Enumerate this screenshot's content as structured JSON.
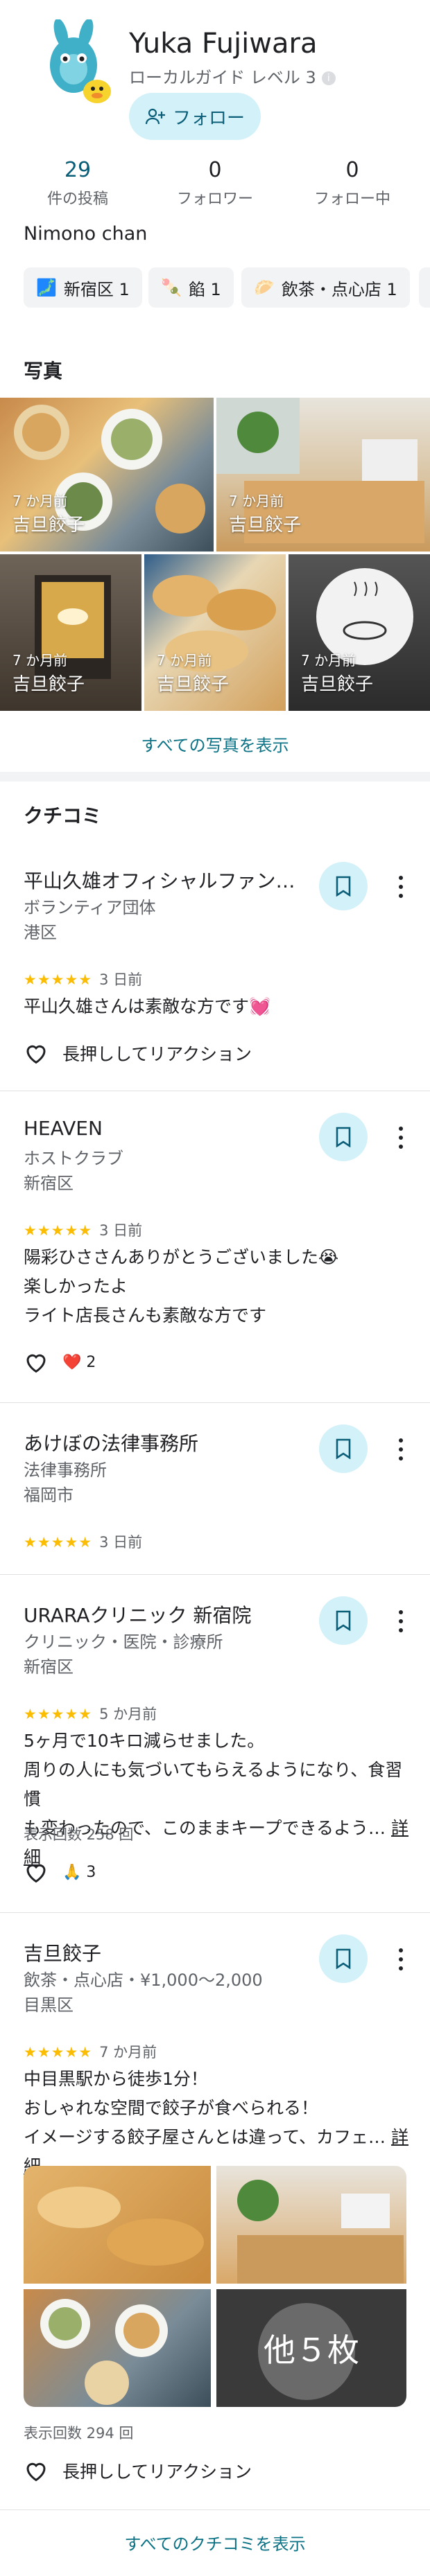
{
  "profile": {
    "name": "Yuka Fujiwara",
    "subtitle": "ローカルガイド レベル 3",
    "info": "i",
    "follow_label": "フォロー",
    "bio": "Nimono chan"
  },
  "stats": [
    {
      "num": "29",
      "label": "件の投稿"
    },
    {
      "num": "0",
      "label": "フォロワー"
    },
    {
      "num": "0",
      "label": "フォロー中"
    }
  ],
  "chips": [
    {
      "icon": "🗾",
      "label": "新宿区 1"
    },
    {
      "icon": "🍡",
      "label": "餡 1"
    },
    {
      "icon": "🥟",
      "label": "飲茶・点心店 1"
    }
  ],
  "photos": {
    "title": "写真",
    "items": [
      {
        "date": "7 か月前",
        "name": "吉旦餃子"
      },
      {
        "date": "7 か月前",
        "name": "吉旦餃子"
      },
      {
        "date": "7 か月前",
        "name": "吉旦餃子"
      },
      {
        "date": "7 か月前",
        "name": "吉旦餃子"
      },
      {
        "date": "7 か月前",
        "name": "吉旦餃子"
      }
    ],
    "show_all": "すべての写真を表示"
  },
  "reviews": {
    "title": "クチコミ",
    "items": [
      {
        "title": "平山久雄オフィシャルファンク…",
        "category": "ボランティア団体",
        "location": "港区",
        "stars": "★★★★★",
        "date": "3 日前",
        "text": [
          "平山久雄さんは素敵な方です💓"
        ],
        "reaction": "長押ししてリアクション"
      },
      {
        "title": "HEAVEN",
        "category": "ホストクラブ",
        "location": "新宿区",
        "stars": "★★★★★",
        "date": "3 日前",
        "text": [
          "陽彩ひささんありがとうございました😭",
          "楽しかったよ",
          "ライト店長さんも素敵な方です"
        ],
        "reaction_emoji": "❤️",
        "reaction_count": "2"
      },
      {
        "title": "あけぼの法律事務所",
        "category": "法律事務所",
        "location": "福岡市",
        "stars": "★★★★★",
        "date": "3 日前"
      },
      {
        "title": "URARAクリニック 新宿院",
        "category": "クリニック・医院・診療所",
        "location": "新宿区",
        "stars": "★★★★★",
        "date": "5 か月前",
        "text": [
          "5ヶ月で10キロ減らせました。",
          "周りの人にも気づいてもらえるようになり、食習慣",
          "も変わったので、このままキープできるよう…"
        ],
        "more": "詳細",
        "views": "表示回数 258 回",
        "reaction_emoji": "🙏",
        "reaction_count": "3"
      },
      {
        "title": "吉旦餃子",
        "category": "飲茶・点心店・¥1,000〜2,000",
        "location": "目黒区",
        "stars": "★★★★★",
        "date": "7 か月前",
        "text": [
          "中目黒駅から徒歩1分！",
          "おしゃれな空間で餃子が食べられる！",
          "イメージする餃子屋さんとは違って、カフェ…"
        ],
        "more": "詳細",
        "more_photos": "他５枚",
        "views": "表示回数 294 回",
        "reaction": "長押ししてリアクション"
      }
    ],
    "show_all": "すべてのクチコミを表示"
  },
  "colors": {
    "accent": "#d3f1f9",
    "accent_text": "#0b5e78",
    "star": "#fbbc04",
    "link": "#0b7285"
  }
}
